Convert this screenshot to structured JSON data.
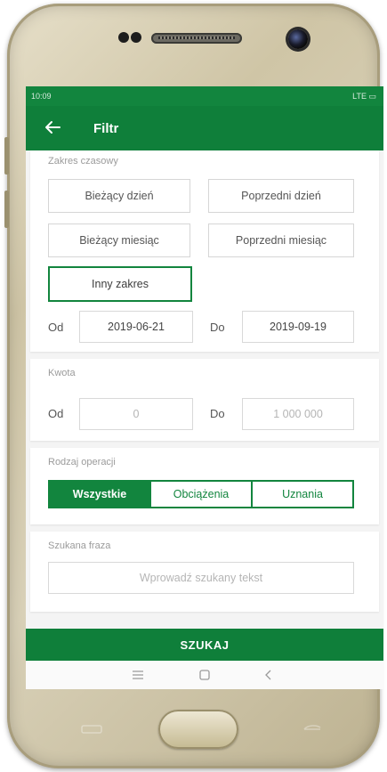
{
  "statusbar": {
    "time": "10:09",
    "icons": " LTE ▭"
  },
  "toolbar": {
    "back_icon": "arrow-left-icon",
    "title": "Filtr"
  },
  "time_range": {
    "label": "Zakres czasowy",
    "current_day": "Bieżący dzień",
    "previous_day": "Poprzedni dzień",
    "current_month": "Bieżący miesiąc",
    "previous_month": "Poprzedni miesiąc",
    "other_range": "Inny zakres",
    "from_label": "Od",
    "from_value": "2019-06-21",
    "to_label": "Do",
    "to_value": "2019-09-19"
  },
  "amount": {
    "label": "Kwota",
    "from_label": "Od",
    "from_placeholder": "0",
    "to_label": "Do",
    "to_placeholder": "1 000 000"
  },
  "operation_type": {
    "label": "Rodzaj operacji",
    "options": [
      "Wszystkie",
      "Obciążenia",
      "Uznania"
    ],
    "selected": "Wszystkie"
  },
  "search_phrase": {
    "label": "Szukana fraza",
    "placeholder": "Wprowadź szukany tekst"
  },
  "search_button": "SZUKAJ",
  "colors": {
    "accent": "#12853e",
    "toolbar": "#0f7f3a"
  }
}
